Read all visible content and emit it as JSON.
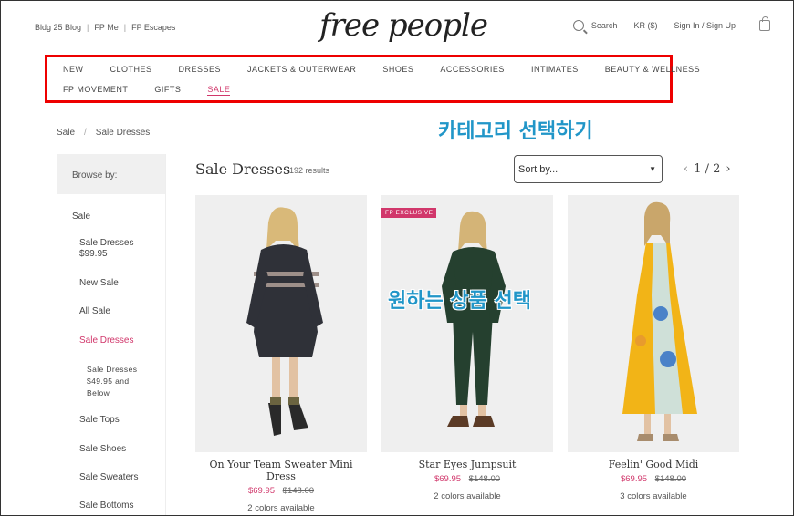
{
  "header": {
    "top_links": [
      "Bldg 25 Blog",
      "FP Me",
      "FP Escapes"
    ],
    "logo": "free people",
    "search_label": "Search",
    "currency": "KR ($)",
    "sign_in": "Sign In / Sign Up"
  },
  "nav": {
    "row1": [
      "NEW",
      "CLOTHES",
      "DRESSES",
      "JACKETS & OUTERWEAR",
      "SHOES",
      "ACCESSORIES",
      "INTIMATES",
      "BEAUTY & WELLNESS"
    ],
    "row2": [
      "FP MOVEMENT",
      "GIFTS",
      "SALE"
    ]
  },
  "annotations": {
    "category": "카테고리 선택하기",
    "product": "원하는 상품 선택"
  },
  "breadcrumb": [
    "Sale",
    "Sale Dresses"
  ],
  "sidebar": {
    "browse": "Browse by:",
    "items": [
      {
        "label": "Sale"
      },
      {
        "label": "Sale Dresses $99.95"
      },
      {
        "label": "New Sale"
      },
      {
        "label": "All Sale"
      },
      {
        "label": "Sale Dresses"
      },
      {
        "label": "Sale Dresses $49.95 and Below"
      },
      {
        "label": "Sale Tops"
      },
      {
        "label": "Sale Shoes"
      },
      {
        "label": "Sale Sweaters"
      },
      {
        "label": "Sale Bottoms"
      }
    ]
  },
  "listing": {
    "title": "Sale Dresses",
    "count": "192 results",
    "sort": "Sort by...",
    "page": "1 / 2"
  },
  "products": [
    {
      "name": "On Your Team Sweater Mini Dress",
      "price": "$69.95",
      "was": "$148.00",
      "colors": "2 colors available",
      "badge": ""
    },
    {
      "name": "Star Eyes Jumpsuit",
      "price": "$69.95",
      "was": "$148.00",
      "colors": "2 colors available",
      "badge": "FP EXCLUSIVE"
    },
    {
      "name": "Feelin' Good Midi",
      "price": "$69.95",
      "was": "$148.00",
      "colors": "3 colors available",
      "badge": ""
    }
  ],
  "colors": {
    "accent": "#d1376b",
    "annotation": "#2196c8",
    "highlight_box": "#ee0000"
  }
}
